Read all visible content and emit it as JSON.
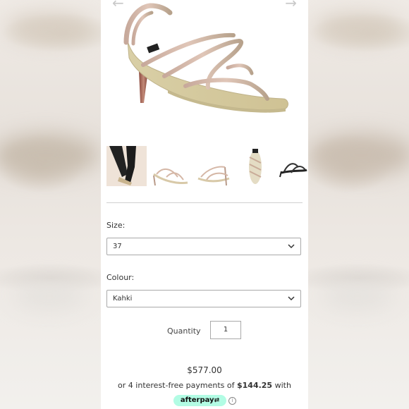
{
  "product": {
    "image_alt": "strappy sandal",
    "thumbnails": [
      {
        "icon": "model-legs-thumbnail"
      },
      {
        "icon": "sandal-side-thumbnail"
      },
      {
        "icon": "sandal-front-thumbnail"
      },
      {
        "icon": "sandal-top-thumbnail"
      },
      {
        "icon": "sandal-black-thumbnail"
      }
    ]
  },
  "options": {
    "size_label": "Size:",
    "size_value": "37",
    "colour_label": "Colour:",
    "colour_value": "Kahki"
  },
  "quantity": {
    "label": "Quantity",
    "value": "1"
  },
  "pricing": {
    "price": "$577.00",
    "installment_prefix": "or 4 interest-free payments of ",
    "installment_amount": "$144.25",
    "installment_suffix": " with",
    "afterpay_label": "afterpay",
    "afterpay_color": "#b2fce4"
  }
}
